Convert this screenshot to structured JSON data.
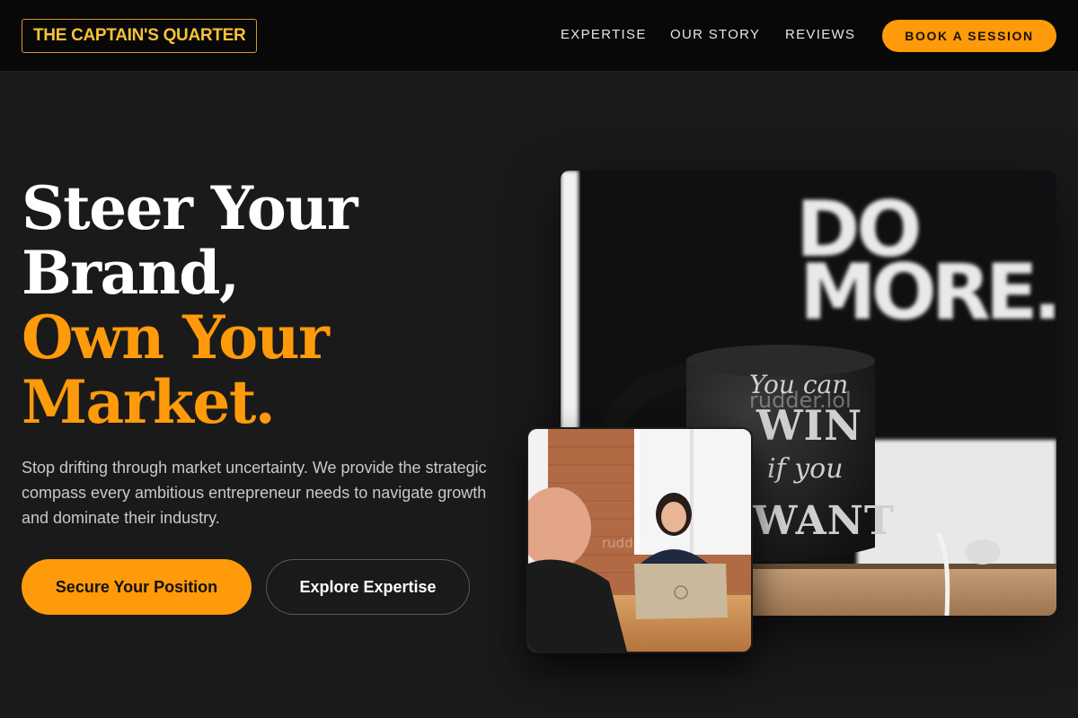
{
  "header": {
    "logo": "THE CAPTAIN'S QUARTER",
    "nav": [
      "EXPERTISE",
      "OUR STORY",
      "REVIEWS"
    ],
    "cta": "BOOK A SESSION"
  },
  "hero": {
    "headline": {
      "line1": "Steer Your",
      "line2": "Brand,",
      "line3": "Own Your",
      "line4": "Market."
    },
    "subtext": "Stop drifting through market uncertainty. We provide the strategic compass every ambitious entrepreneur needs to navigate growth and dominate their industry.",
    "primary_button": "Secure Your Position",
    "secondary_button": "Explore Expertise"
  },
  "images": {
    "main": {
      "sign_text_line1": "DO",
      "sign_text_line2": "MORE.",
      "mug_text_line1": "You can",
      "mug_text_line2": "WIN",
      "mug_text_line3": "if you",
      "mug_text_line4": "WANT",
      "watermark": "rudder.lol"
    },
    "small": {
      "watermark": "rudder.lol"
    }
  },
  "colors": {
    "accent": "#ff9a0a",
    "logo_text": "#f6c235",
    "background": "#1a1a1a",
    "header_bg": "#080808"
  }
}
